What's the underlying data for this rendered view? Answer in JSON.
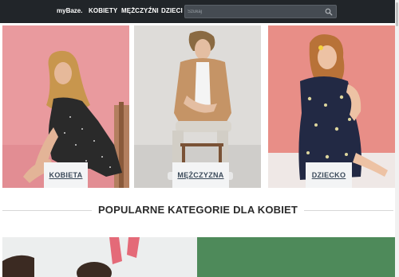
{
  "navbar": {
    "brand": "myBaze.",
    "links": [
      "KOBIETY",
      "MĘŻCZYŹNI",
      "DZIECI"
    ],
    "search_placeholder": "Szukaj"
  },
  "cards": [
    {
      "label": "KOBIETA"
    },
    {
      "label": "MĘŻCZYZNA"
    },
    {
      "label": "DZIECKO"
    }
  ],
  "section": {
    "title": "POPULARNE KATEGORIE DLA KOBIET"
  },
  "colors": {
    "navbar_bg": "#212529",
    "card1_bg": "#e99a9e",
    "card2_bg": "#dcdcdc",
    "card3_bg": "#e88e87",
    "promo_green": "#4e8a5a"
  }
}
